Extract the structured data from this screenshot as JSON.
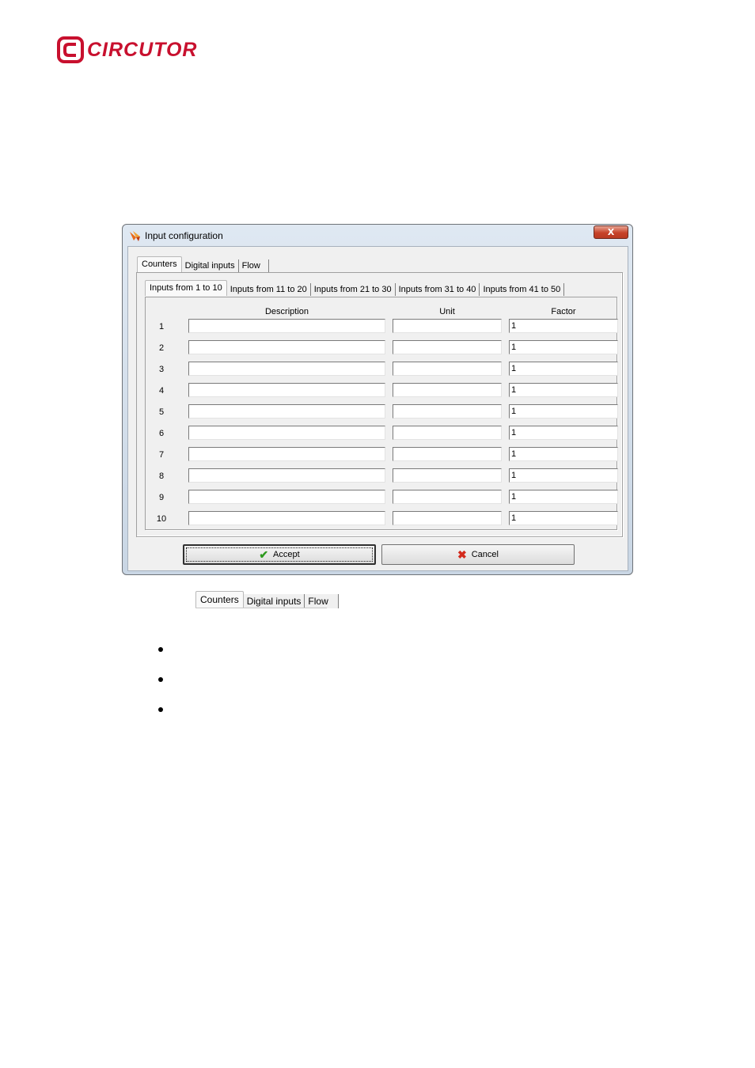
{
  "logo": {
    "text": "CIRCUTOR",
    "color": "#c8102e"
  },
  "dialog": {
    "title": "Input configuration",
    "close_label": "X",
    "main_tabs": [
      "Counters",
      "Digital inputs",
      "Flow"
    ],
    "sub_tabs": [
      "Inputs from 1 to 10",
      "Inputs from 11 to 20",
      "Inputs from 21 to 30",
      "Inputs from 31 to 40",
      "Inputs from 41 to 50"
    ],
    "columns": {
      "description": "Description",
      "unit": "Unit",
      "factor": "Factor"
    },
    "rows": [
      {
        "num": "1",
        "description": "",
        "unit": "",
        "factor": "1"
      },
      {
        "num": "2",
        "description": "",
        "unit": "",
        "factor": "1"
      },
      {
        "num": "3",
        "description": "",
        "unit": "",
        "factor": "1"
      },
      {
        "num": "4",
        "description": "",
        "unit": "",
        "factor": "1"
      },
      {
        "num": "5",
        "description": "",
        "unit": "",
        "factor": "1"
      },
      {
        "num": "6",
        "description": "",
        "unit": "",
        "factor": "1"
      },
      {
        "num": "7",
        "description": "",
        "unit": "",
        "factor": "1"
      },
      {
        "num": "8",
        "description": "",
        "unit": "",
        "factor": "1"
      },
      {
        "num": "9",
        "description": "",
        "unit": "",
        "factor": "1"
      },
      {
        "num": "10",
        "description": "",
        "unit": "",
        "factor": "1"
      }
    ],
    "accept_label": "Accept",
    "cancel_label": "Cancel",
    "accept_icon": "check-icon",
    "cancel_icon": "cross-icon"
  },
  "tab_strip_figure": {
    "tabs": [
      "Counters",
      "Digital inputs",
      "Flow"
    ]
  }
}
